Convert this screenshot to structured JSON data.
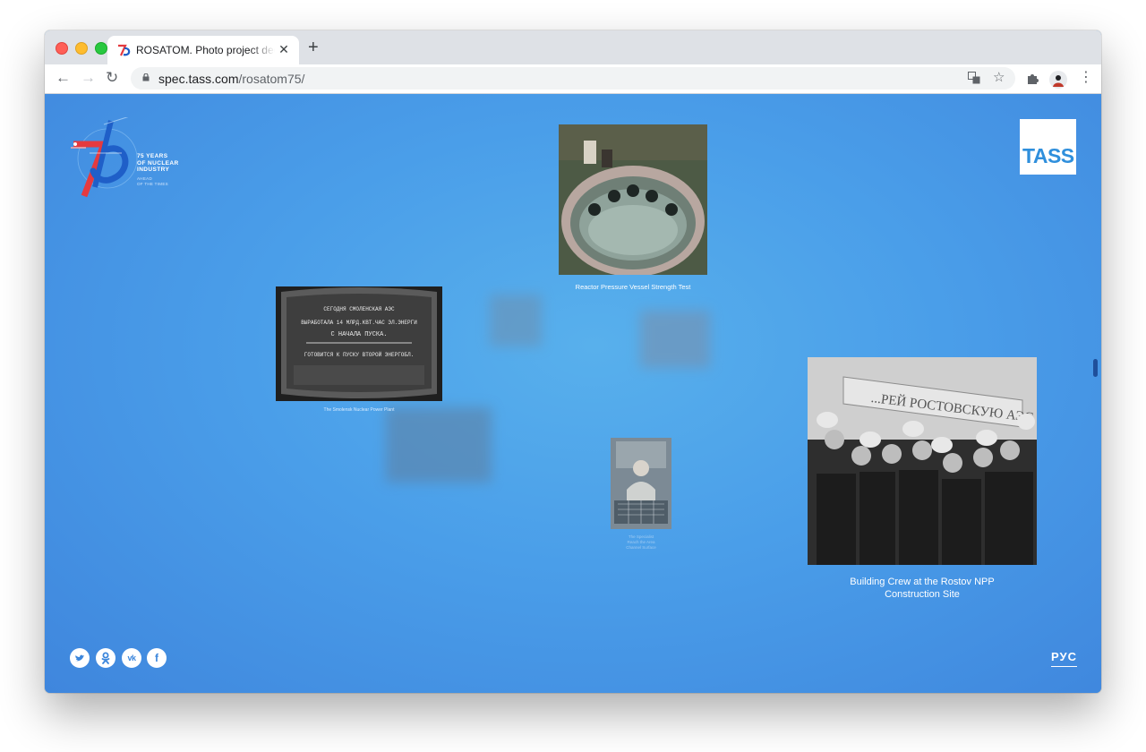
{
  "browser": {
    "tab_title": "ROSATOM. Photo project dedic",
    "tab_close": "✕",
    "new_tab": "+",
    "url_host": "spec.tass.com",
    "url_path": "/rosatom75/",
    "back": "←",
    "forward": "→",
    "reload": "↻",
    "translate_icon": "translate-icon",
    "star_icon": "☆",
    "extension_icon": "puzzle-icon",
    "menu_icon": "⋮"
  },
  "site": {
    "logo_lines": [
      "75 YEARS",
      "OF NUCLEAR",
      "INDUSTRY"
    ],
    "logo_subtitle": "AHEAD\nOF THE TIMES",
    "tass_logo": "TASS",
    "lang": "РУС"
  },
  "photos": {
    "reactor": {
      "caption": "Reactor Pressure Vessel Strength Test"
    },
    "smolensk": {
      "caption": "The Smolensk Nuclear Power Plant",
      "board_lines": [
        "СЕГОДНЯ СМОЛЕНСКАЯ АЭС",
        "ВЫРАБОТАЛА 14 МЛРД.КВТ.ЧАС ЭЛ.ЭНЕРГИ",
        "С НАЧАЛА ПУСКА.",
        "ГОТОВИТСЯ К ПУСКУ ВТОРОЙ ЭНЕРГОБЛ."
      ]
    },
    "worker": {
      "caption_lines": [
        "The Specialist",
        "Reach the Area",
        "Channel Surface"
      ]
    },
    "rostov": {
      "caption_lines": [
        "Building Crew at the Rostov NPP",
        "Construction Site"
      ],
      "banner": "...РЕЙ РОСТОВСКУЮ АЭС"
    }
  },
  "social": [
    {
      "name": "twitter",
      "glyph": "t"
    },
    {
      "name": "odnoklassniki",
      "glyph": "ok"
    },
    {
      "name": "vk",
      "glyph": "vk"
    },
    {
      "name": "facebook",
      "glyph": "f"
    }
  ],
  "colors": {
    "page_bg": "#4a9ee9",
    "accent_red": "#e53a3f",
    "accent_blue": "#1f5fc8"
  }
}
